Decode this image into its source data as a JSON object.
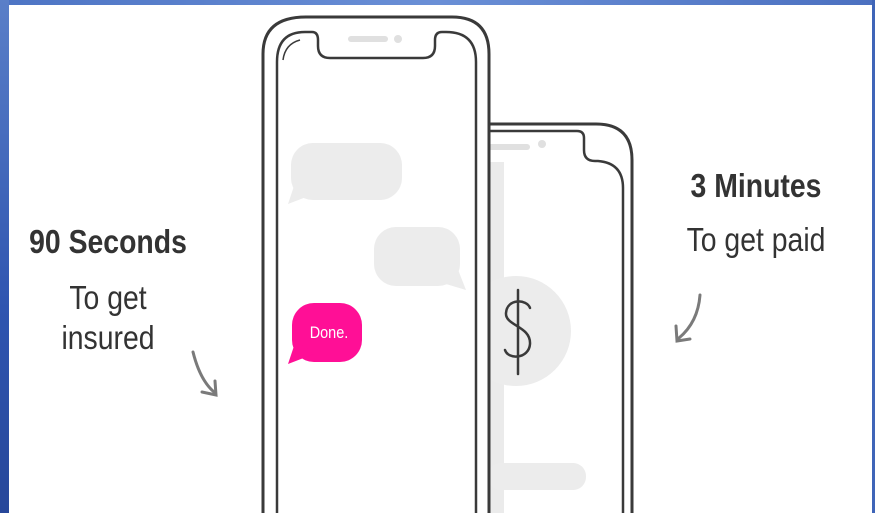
{
  "captions": {
    "left": {
      "headline": "90 Seconds",
      "subtitle": "To get insured"
    },
    "right": {
      "headline": "3 Minutes",
      "subtitle": "To get paid"
    }
  },
  "chat": {
    "done_message": "Done."
  },
  "payment": {
    "currency_symbol": "$"
  },
  "colors": {
    "accent": "#ff0f96",
    "phone_outline": "#3a3a3a",
    "bubble_gray": "#ececec",
    "text": "#333333",
    "frame_blue": "#3a60b8"
  },
  "icons": [
    "curved-arrow-down-left-icon",
    "curved-arrow-down-right-icon",
    "dollar-icon"
  ]
}
